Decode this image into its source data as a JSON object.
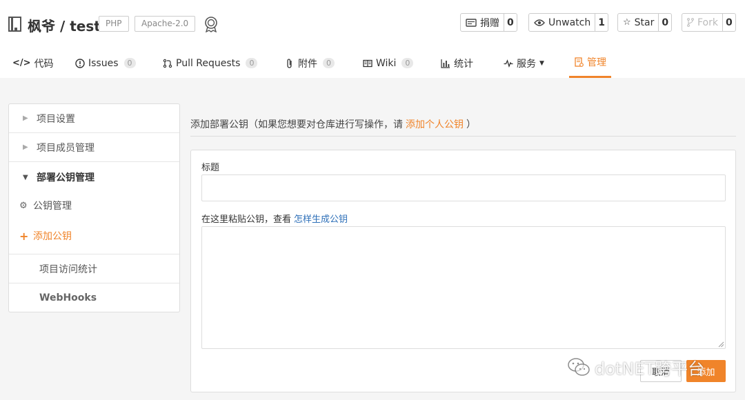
{
  "repo": {
    "title": "枫爷 / test",
    "language_tag": "PHP",
    "license_tag": "Apache-2.0"
  },
  "actions": [
    {
      "label": "捐赠",
      "count": "0",
      "icon": "donate-icon"
    },
    {
      "label": "Unwatch",
      "count": "1",
      "icon": "eye-icon"
    },
    {
      "label": "Star",
      "count": "0",
      "icon": "star-icon"
    },
    {
      "label": "Fork",
      "count": "0",
      "icon": "fork-icon"
    }
  ],
  "nav": [
    {
      "label": "代码",
      "icon": "code-icon"
    },
    {
      "label": "Issues",
      "count": "0",
      "icon": "issue-icon"
    },
    {
      "label": "Pull Requests",
      "count": "0",
      "icon": "pull-request-icon"
    },
    {
      "label": "附件",
      "count": "0",
      "icon": "paperclip-icon"
    },
    {
      "label": "Wiki",
      "count": "0",
      "icon": "book-icon"
    },
    {
      "label": "统计",
      "icon": "bar-chart-icon"
    },
    {
      "label": "服务",
      "icon": "pulse-icon"
    },
    {
      "label": "管理",
      "icon": "settings-doc-icon",
      "active": true
    }
  ],
  "sidebar": {
    "items": [
      {
        "label": "项目设置"
      },
      {
        "label": "项目成员管理"
      },
      {
        "label": "部署公钥管理"
      }
    ],
    "sub_items": [
      {
        "label": "公钥管理",
        "icon": "gear-icon"
      },
      {
        "label": "添加公钥",
        "icon": "plus-icon"
      }
    ],
    "plain_items": [
      {
        "label": "项目访问统计"
      },
      {
        "label": "WebHooks"
      }
    ]
  },
  "main": {
    "header_prefix": "添加部署公钥（如果您想要对仓库进行写操作，请",
    "header_link": "添加个人公钥",
    "header_suffix": "）",
    "title_label": "标题",
    "title_value": "",
    "key_label_prefix": "在这里粘贴公钥，查看",
    "key_label_link": "怎样生成公钥",
    "key_value": "",
    "cancel_label": "取消",
    "add_label": "添加"
  },
  "watermark": {
    "text": "dotNET跨平台"
  },
  "colors": {
    "accent": "#f0842a",
    "link_blue": "#2d6fb8"
  }
}
